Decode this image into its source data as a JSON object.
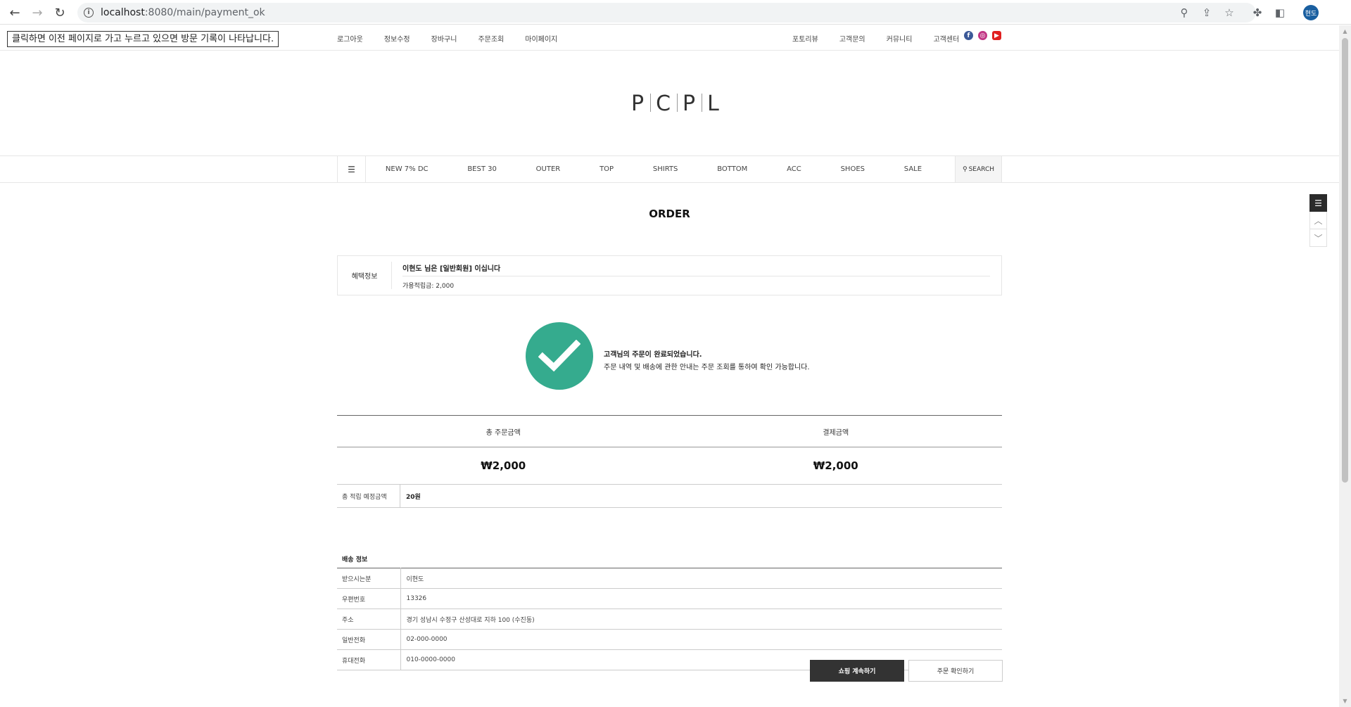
{
  "browser": {
    "url_host": "localhost",
    "url_rest": ":8080/main/payment_ok",
    "profile_initials": "현도"
  },
  "tooltip": "클릭하면 이전 페이지로 가고 누르고 있으면 방문 기록이 나타납니다.",
  "top_links_left": [
    "로그아웃",
    "정보수정",
    "장바구니",
    "주문조회",
    "마이페이지"
  ],
  "top_links_right": [
    "포토리뷰",
    "고객문의",
    "커뮤니티",
    "고객센터"
  ],
  "logo": [
    "P",
    "C",
    "P",
    "L"
  ],
  "gnb": {
    "menu": [
      "NEW 7% DC",
      "BEST 30",
      "OUTER",
      "TOP",
      "SHIRTS",
      "BOTTOM",
      "ACC",
      "SHOES",
      "SALE"
    ],
    "search_label": "SEARCH"
  },
  "page_title": "ORDER",
  "benefit": {
    "label": "혜택정보",
    "member_line": "이현도 님은 [일반회원] 이십니다",
    "points_line": "가용적립금: 2,000"
  },
  "completion": {
    "title": "고객님의 주문이 완료되었습니다.",
    "note": "주문 내역 및 배송에 관한 안내는 주문 조회를 통하여 확인 가능합니다."
  },
  "totals": {
    "order_total_label": "총 주문금액",
    "payment_label": "결제금액",
    "order_total_value": "₩2,000",
    "payment_value": "₩2,000",
    "points_label": "총 적립 예정금액",
    "points_value": "20원"
  },
  "shipping": {
    "title": "배송 정보",
    "rows": [
      {
        "label": "받으시는분",
        "value": "이현도"
      },
      {
        "label": "우편번호",
        "value": "13326"
      },
      {
        "label": "주소",
        "value": "경기 성남시 수정구 산성대로 지하 100 (수진동)"
      },
      {
        "label": "일반전화",
        "value": "02-000-0000"
      },
      {
        "label": "휴대전화",
        "value": "010-0000-0000"
      }
    ]
  },
  "buttons": {
    "continue": "쇼핑 계속하기",
    "confirm": "주문 확인하기"
  },
  "colors": {
    "check_green": "#35ab8e",
    "dark_button": "#333333"
  }
}
